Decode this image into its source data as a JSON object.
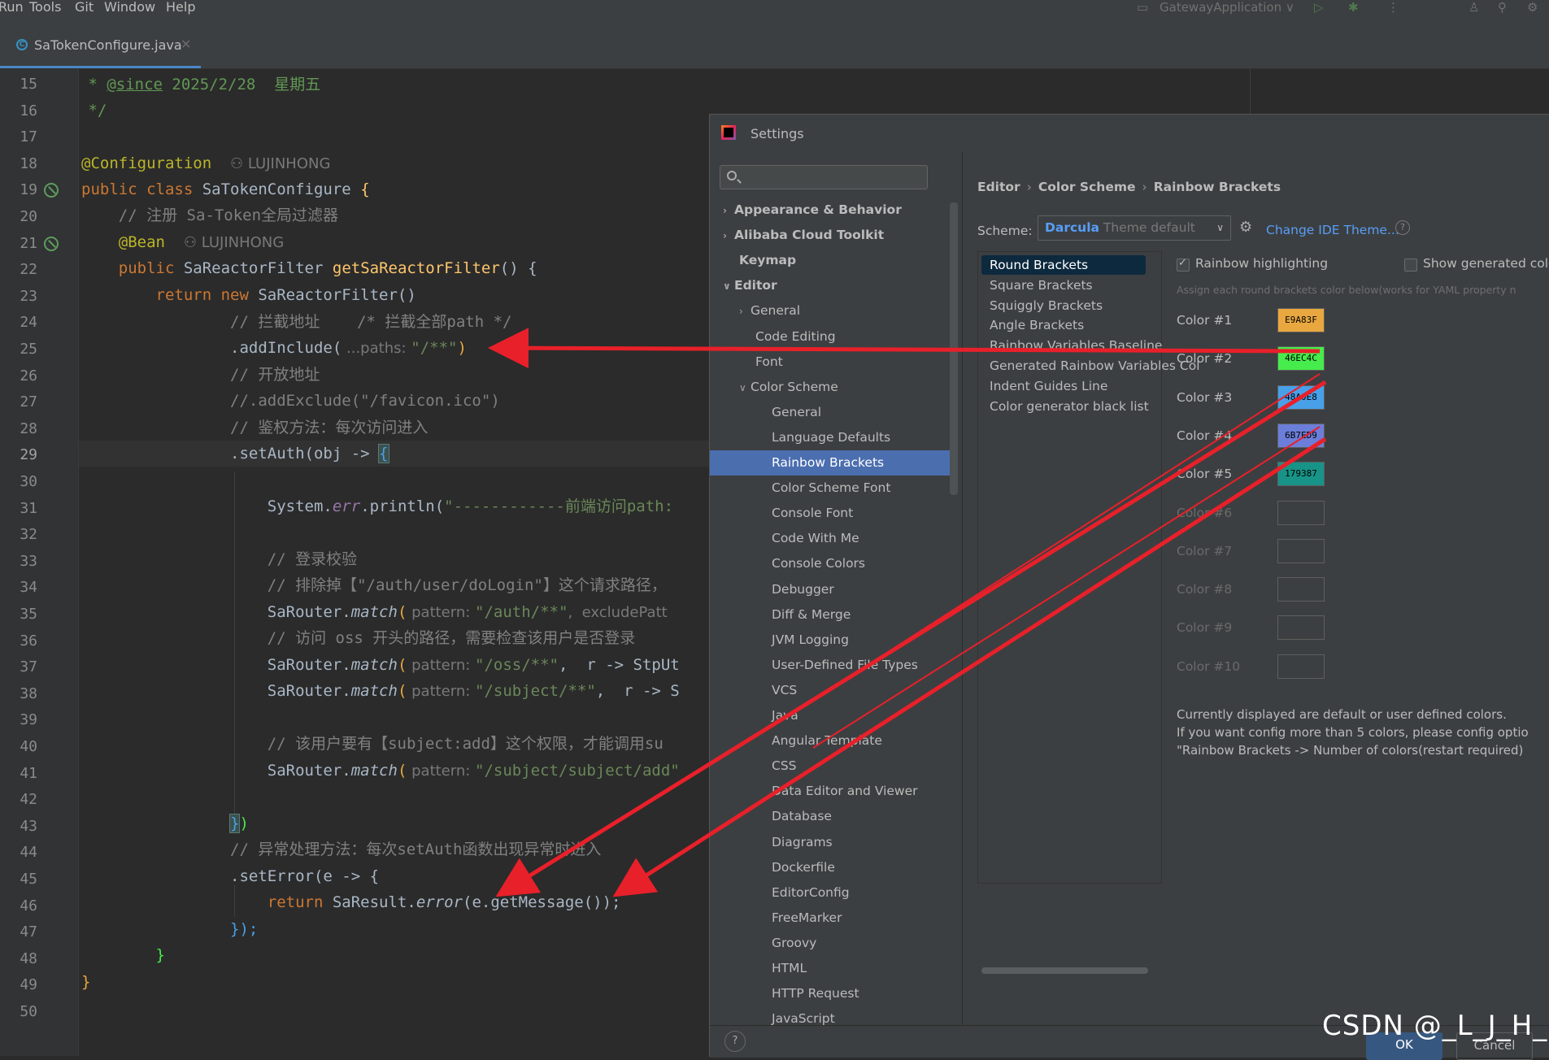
{
  "menu": [
    "Run",
    "Tools",
    "Git",
    "Window",
    "Help"
  ],
  "toolbar": {
    "run_config": "GatewayApplication ∨"
  },
  "editor_tab": {
    "label": "SaTokenConfigure.java",
    "close": "×"
  },
  "line_numbers": [
    "15",
    "16",
    "17",
    "18",
    "19",
    "20",
    "21",
    "22",
    "23",
    "24",
    "25",
    "26",
    "27",
    "28",
    "29",
    "30",
    "31",
    "32",
    "33",
    "34",
    "35",
    "36",
    "37",
    "38",
    "39",
    "40",
    "41",
    "42",
    "43",
    "44",
    "45",
    "46",
    "47",
    "48",
    "49",
    "50"
  ],
  "code": {
    "l15a": " * ",
    "l15b": "@since",
    "l15c": " 2025/2/28  星期五",
    "l16": " */",
    "l18a": "@Configuration",
    "l18b": "LUJINHONG",
    "l19a": "public class ",
    "l19b": "SaTokenConfigure ",
    "l19c": "{",
    "l20": "    // 注册 Sa-Token全局过滤器",
    "l21a": "    @Bean",
    "l21b": "LUJINHONG",
    "l22a": "    public ",
    "l22b": "SaReactorFilter ",
    "l22c": "getSaReactorFilter",
    "l22d": "() {",
    "l23a": "        return new ",
    "l23b": "SaReactorFilter()",
    "l24": "                // 拦截地址    /* 拦截全部path */",
    "l25a": "                .addInclude(",
    "l25b": " ...paths: ",
    "l25c": "\"/**\"",
    "l25d": ")",
    "l26": "                // 开放地址",
    "l27": "                //.addExclude(\"/favicon.ico\")",
    "l28": "                // 鉴权方法：每次访问进入",
    "l29a": "                .setAuth(obj -> ",
    "l29b": "{",
    "l31a": "                    System.",
    "l31b": "err",
    "l31c": ".println(",
    "l31d": "\"------------前端访问path:",
    "l33": "                    // 登录校验",
    "l34": "                    // 排除掉【\"/auth/user/doLogin\"】这个请求路径，",
    "l35a": "                    SaRouter.",
    "l35b": "match",
    "l35c": "(",
    "l35d": " pattern: ",
    "l35e": "\"/auth/**\"",
    "l35f": ",  excludePatt",
    "l36": "                    // 访问 oss 开头的路径，需要检查该用户是否登录",
    "l37a": "                    SaRouter.",
    "l37b": "match",
    "l37c": "(",
    "l37d": " pattern: ",
    "l37e": "\"/oss/**\"",
    "l37f": ",  r -> StpUt",
    "l38a": "                    SaRouter.",
    "l38b": "match",
    "l38c": "(",
    "l38d": " pattern: ",
    "l38e": "\"/subject/**\"",
    "l38f": ",  r -> S",
    "l40": "                    // 该用户要有【subject:add】这个权限，才能调用su",
    "l41a": "                    SaRouter.",
    "l41b": "match",
    "l41c": "(",
    "l41d": " pattern: ",
    "l41e": "\"/subject/subject/add\"",
    "l43a": "                ",
    "l43b": "}",
    "l43c": ")",
    "l44": "                // 异常处理方法：每次setAuth函数出现异常时进入",
    "l45": "                .setError(e -> {",
    "l46a": "                    return ",
    "l46b": "SaResult.",
    "l46c": "error",
    "l46d": "(e.getMessage());",
    "l47": "                });",
    "l48": "        }",
    "l49": "}"
  },
  "settings": {
    "title": "Settings",
    "search_placeholder": "",
    "tree": [
      {
        "label": "Appearance & Behavior",
        "arrow": "›"
      },
      {
        "label": "Alibaba Cloud Toolkit",
        "arrow": "›"
      },
      {
        "label": "Keymap",
        "arrow": ""
      },
      {
        "label": "Editor",
        "arrow": "∨"
      },
      {
        "label": "General",
        "arrow": "›"
      },
      {
        "label": "Code Editing",
        "arrow": ""
      },
      {
        "label": "Font",
        "arrow": ""
      },
      {
        "label": "Color Scheme",
        "arrow": "∨"
      },
      {
        "label": "General"
      },
      {
        "label": "Language Defaults"
      },
      {
        "label": "Rainbow Brackets"
      },
      {
        "label": "Color Scheme Font"
      },
      {
        "label": "Console Font"
      },
      {
        "label": "Code With Me"
      },
      {
        "label": "Console Colors"
      },
      {
        "label": "Debugger"
      },
      {
        "label": "Diff & Merge"
      },
      {
        "label": "JVM Logging"
      },
      {
        "label": "User-Defined File Types"
      },
      {
        "label": "VCS"
      },
      {
        "label": "Java"
      },
      {
        "label": "Angular Template"
      },
      {
        "label": "CSS"
      },
      {
        "label": "Data Editor and Viewer"
      },
      {
        "label": "Database"
      },
      {
        "label": "Diagrams"
      },
      {
        "label": "Dockerfile"
      },
      {
        "label": "EditorConfig"
      },
      {
        "label": "FreeMarker"
      },
      {
        "label": "Groovy"
      },
      {
        "label": "HTML"
      },
      {
        "label": "HTTP Request"
      },
      {
        "label": "JavaScript"
      }
    ],
    "breadcrumb": [
      "Editor",
      "Color Scheme",
      "Rainbow Brackets"
    ],
    "breadcrumb_sep": "›",
    "scheme_label": "Scheme:",
    "scheme_name": "Darcula",
    "scheme_desc": " Theme default",
    "change_theme": "Change IDE Theme...",
    "bracket_types": [
      "Round Brackets",
      "Square Brackets",
      "Squiggly Brackets",
      "Angle Brackets",
      "Rainbow Variables Baseline",
      "Generated Rainbow Variables Col",
      "Indent Guides Line",
      "Color generator black list"
    ],
    "rainbow_highlighting": "Rainbow highlighting",
    "show_generated": "Show generated color",
    "assign_note": "Assign each round brackets color below(works for YAML property n",
    "colors": [
      {
        "label": "Color #1",
        "hex": "#E9A83F",
        "text": "E9A83F"
      },
      {
        "label": "Color #2",
        "hex": "#46EC4C",
        "text": "46EC4C"
      },
      {
        "label": "Color #3",
        "hex": "#48A0E8",
        "text": "48A0E8"
      },
      {
        "label": "Color #4",
        "hex": "#6B7ED9",
        "text": "6B7ED9"
      },
      {
        "label": "Color #5",
        "hex": "#179387",
        "text": "179387"
      },
      {
        "label": "Color #6",
        "hex": "",
        "text": ""
      },
      {
        "label": "Color #7",
        "hex": "",
        "text": ""
      },
      {
        "label": "Color #8",
        "hex": "",
        "text": ""
      },
      {
        "label": "Color #9",
        "hex": "",
        "text": ""
      },
      {
        "label": "Color #10",
        "hex": "",
        "text": ""
      }
    ],
    "info_lines": [
      "Currently displayed are default or user defined colors.",
      "If you want config more than 5 colors, please config optio",
      "\"Rainbow Brackets -> Number of colors(restart required)"
    ],
    "ok": "OK",
    "cancel": "Cancel"
  },
  "watermark": "CSDN @_L_J_H_",
  "accent_colors": {
    "arrow": "#e8202a",
    "selection": "#4b6eaf",
    "link": "#589df6"
  }
}
